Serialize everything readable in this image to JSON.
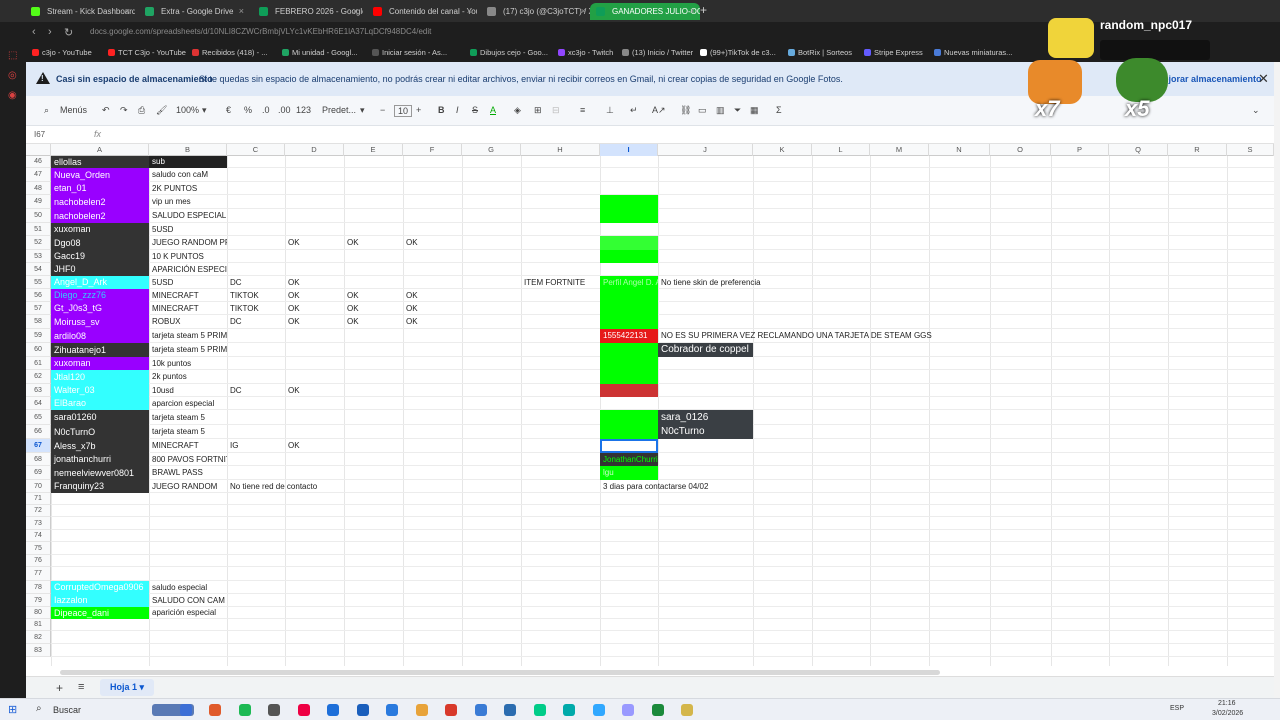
{
  "browser": {
    "tabs": [
      {
        "title": "Stream - Kick Dashboard",
        "color": "#53fc18"
      },
      {
        "title": "Extra - Google Drive",
        "color": "#1fa463"
      },
      {
        "title": "FEBRERO 2026 - Google S",
        "color": "#0f9d58"
      },
      {
        "title": "Contenido del canal - You",
        "color": "#ff0000"
      },
      {
        "title": "(17) c3jo (@C3joTCT) / X",
        "color": "#888888"
      },
      {
        "title": "GANADORES JULIO-OCT",
        "color": "#0f9d58"
      }
    ],
    "url": "docs.google.com/spreadsheets/d/10NLI8CZWCrBmbjVLYc1vKEbHR6E1lA37LqDCf948DC4/edit",
    "bookmarks": [
      "c3jo - YouTube",
      "TCT C3jo - YouTube",
      "Recibidos (418) - ...",
      "Mi unidad - Googl...",
      "Iniciar sesión - As...",
      "Dibujos cejo - Goo...",
      "xc3jo - Twitch",
      "(13) Inicio / Twitter",
      "(99+)TikTok de c3...",
      "BotRix | Sorteos",
      "Stripe Express",
      "Nuevas miniaturas..."
    ]
  },
  "warning": {
    "title": "Casi sin espacio de almacenamiento",
    "text": "Si te quedas sin espacio de almacenamiento, no podrás crear ni editar archivos, enviar ni recibir correos en Gmail, ni crear copias de seguridad en Google Fotos.",
    "action": "Mejorar almacenamiento"
  },
  "toolbar": {
    "menus": "Menús",
    "zoom": "100%",
    "currency": "€",
    "percent": "%",
    "dec_less": ".0",
    "dec_more": ".00",
    "num": "123",
    "font": "Predet...",
    "size": "10"
  },
  "namebox": "I67",
  "fx": "fx",
  "columns": [
    {
      "name": "A",
      "selected": false
    },
    {
      "name": "B",
      "selected": false
    },
    {
      "name": "C",
      "selected": false
    },
    {
      "name": "D",
      "selected": false
    },
    {
      "name": "E",
      "selected": false
    },
    {
      "name": "F",
      "selected": false
    },
    {
      "name": "G",
      "selected": false
    },
    {
      "name": "H",
      "selected": false
    },
    {
      "name": "I",
      "selected": true
    },
    {
      "name": "J",
      "selected": false
    },
    {
      "name": "K",
      "selected": false
    },
    {
      "name": "L",
      "selected": false
    },
    {
      "name": "M",
      "selected": false
    },
    {
      "name": "N",
      "selected": false
    },
    {
      "name": "O",
      "selected": false
    },
    {
      "name": "P",
      "selected": false
    },
    {
      "name": "Q",
      "selected": false
    },
    {
      "name": "R",
      "selected": false
    },
    {
      "name": "S",
      "selected": false
    }
  ],
  "rows": [
    {
      "n": "46",
      "a": "ellollas",
      "abg": "#333333",
      "afg": "#ffffff",
      "b": "sub",
      "bbg": "#222222",
      "bfg": "#ffffff"
    },
    {
      "n": "47",
      "a": "Nueva_Orden",
      "abg": "#9900ff",
      "afg": "#ffffff",
      "b": "saludo con caM"
    },
    {
      "n": "48",
      "a": "etan_01",
      "abg": "#9900ff",
      "afg": "#ffffff",
      "b": "2K PUNTOS"
    },
    {
      "n": "49",
      "a": "nachobelen2",
      "abg": "#9900ff",
      "afg": "#ffffff",
      "b": "vip un mes",
      "ibg": "#00ff00"
    },
    {
      "n": "50",
      "a": "nachobelen2",
      "abg": "#9900ff",
      "afg": "#ffffff",
      "b": "SALUDO ESPECIAL",
      "ibg": "#00ff00"
    },
    {
      "n": "51",
      "a": "xuxoman",
      "abg": "#333333",
      "afg": "#ffffff",
      "b": "5USD"
    },
    {
      "n": "52",
      "a": "Dgo08",
      "abg": "#333333",
      "afg": "#ffffff",
      "b": "JUEGO RANDOM PRIX",
      "d": "OK",
      "e": "OK",
      "f": "OK",
      "ibg": "#33ff33"
    },
    {
      "n": "53",
      "a": "Gacc19",
      "abg": "#333333",
      "afg": "#ffffff",
      "b": "10 K PUNTOS",
      "ibg": "#00ff00"
    },
    {
      "n": "54",
      "a": "JHF0",
      "abg": "#333333",
      "afg": "#ffffff",
      "b": "APARICIÓN ESPECIAL"
    },
    {
      "n": "55",
      "a": "Angel_D_Ark",
      "abg": "#33ffff",
      "afg": "#ffffff",
      "b": "5USD",
      "c": "DC",
      "d": "OK",
      "h": "ITEM FORTNITE",
      "i": "Perfil Angel D. A",
      "ibg": "#00ff00",
      "ifg": "#aaffaa",
      "j": "No tiene skin de preferencia"
    },
    {
      "n": "56",
      "a": "Diego_zzz76",
      "abg": "#9900ff",
      "afg": "#33ccff",
      "b": "MINECRAFT",
      "c": "TIKTOK",
      "d": "OK",
      "e": "OK",
      "f": "OK",
      "ibg": "#00ff00"
    },
    {
      "n": "57",
      "a": "Gt_J0s3_tG",
      "abg": "#9900ff",
      "afg": "#ffffff",
      "b": "MINECRAFT",
      "c": "TIKTOK",
      "d": "OK",
      "e": "OK",
      "f": "OK",
      "ibg": "#00ff00"
    },
    {
      "n": "58",
      "a": "Moiruss_sv",
      "abg": "#9900ff",
      "afg": "#ffffff",
      "b": "ROBUX",
      "c": "DC",
      "d": "OK",
      "e": "OK",
      "f": "OK",
      "ibg": "#00ff00"
    },
    {
      "n": "59",
      "a": "ardilo08",
      "abg": "#9900ff",
      "afg": "#ffffff",
      "b": "tarjeta steam 5 PRIMERA VEZ",
      "i": "1555422131",
      "ibg": "#e61919",
      "ifg": "#ffffff",
      "j": "NO ES SU PRIMERA VEZ RECLAMANDO UNA TARJETA DE STEAM GGS"
    },
    {
      "n": "60",
      "a": "Zihuatanejo1",
      "abg": "#333333",
      "afg": "#ffffff",
      "b": "tarjeta steam 5 PRIMERA VEZ",
      "ibg": "#00ff00",
      "j": "Cobrador de coppel",
      "jbg": "#3a3f44",
      "jfg": "#ffffff"
    },
    {
      "n": "61",
      "a": "xuxoman",
      "abg": "#9900ff",
      "afg": "#ffffff",
      "b": "10k puntos",
      "ibg": "#00ff00"
    },
    {
      "n": "62",
      "a": "Jtlal120",
      "abg": "#33ffff",
      "afg": "#ffffff",
      "b": "2k puntos",
      "ibg": "#00ff00"
    },
    {
      "n": "63",
      "a": "Walter_03",
      "abg": "#33ffff",
      "afg": "#ffffff",
      "b": "10usd",
      "c": "DC",
      "d": "OK",
      "ibg": "#cc3333"
    },
    {
      "n": "64",
      "a": "ElBarao",
      "abg": "#33ffff",
      "afg": "#ffffff",
      "b": "aparcion especial"
    },
    {
      "n": "65",
      "a": "sara01260",
      "abg": "#333333",
      "afg": "#ffffff",
      "b": "tarjeta steam 5",
      "ibg": "#00ff00",
      "j": "sara_0126",
      "jbg": "#3a3f44",
      "jfg": "#ffffff"
    },
    {
      "n": "66",
      "a": "N0cTurnO",
      "abg": "#333333",
      "afg": "#ffffff",
      "b": "tarjeta steam 5",
      "ibg": "#00ff00",
      "j": "N0cTurno",
      "jbg": "#3a3f44",
      "jfg": "#ffffff"
    },
    {
      "n": "67",
      "a": "Aless_x7b",
      "abg": "#333333",
      "afg": "#ffffff",
      "b": "MINECRAFT",
      "c": "IG",
      "d": "OK",
      "selected": true
    },
    {
      "n": "68",
      "a": "jonathanchurri",
      "abg": "#333333",
      "afg": "#ffffff",
      "b": "800 PAVOS FORTNITE",
      "i": "JonathanChurri",
      "ibg": "#333333",
      "ifg": "#00ff00"
    },
    {
      "n": "69",
      "a": "nemeelviewver0801",
      "abg": "#333333",
      "afg": "#ffffff",
      "b": "BRAWL PASS",
      "i": "lgu",
      "ibg": "#00ff00",
      "ifg": "#ccffcc"
    },
    {
      "n": "70",
      "a": "Franquiny23",
      "abg": "#333333",
      "afg": "#ffffff",
      "b": "JUEGO RANDOM",
      "c": "No tiene red de contacto",
      "i": "3 dias para contactarse 04/02"
    },
    {
      "n": "71"
    },
    {
      "n": "72"
    },
    {
      "n": "73"
    },
    {
      "n": "74"
    },
    {
      "n": "75"
    },
    {
      "n": "76"
    },
    {
      "n": "77"
    },
    {
      "n": "78",
      "a": "CorruptedOmega0906",
      "abg": "#33ffff",
      "afg": "#ffffff",
      "b": "saludo especial"
    },
    {
      "n": "79",
      "a": "Iazzalon",
      "abg": "#33ffff",
      "afg": "#ffffff",
      "b": "SALUDO CON CAM"
    },
    {
      "n": "80",
      "a": "Dipeace_dani",
      "abg": "#00ff00",
      "afg": "#ffffff",
      "b": "aparición especial"
    },
    {
      "n": "81"
    },
    {
      "n": "82"
    },
    {
      "n": "83"
    }
  ],
  "sheet": {
    "tab": "Hoja 1"
  },
  "overlay": {
    "username": "random_npc017",
    "badge1": "x7",
    "badge2": "x5"
  },
  "taskbar": {
    "search": "Buscar",
    "lang": "ESP",
    "time": "21:16",
    "date": "3/02/2026"
  }
}
